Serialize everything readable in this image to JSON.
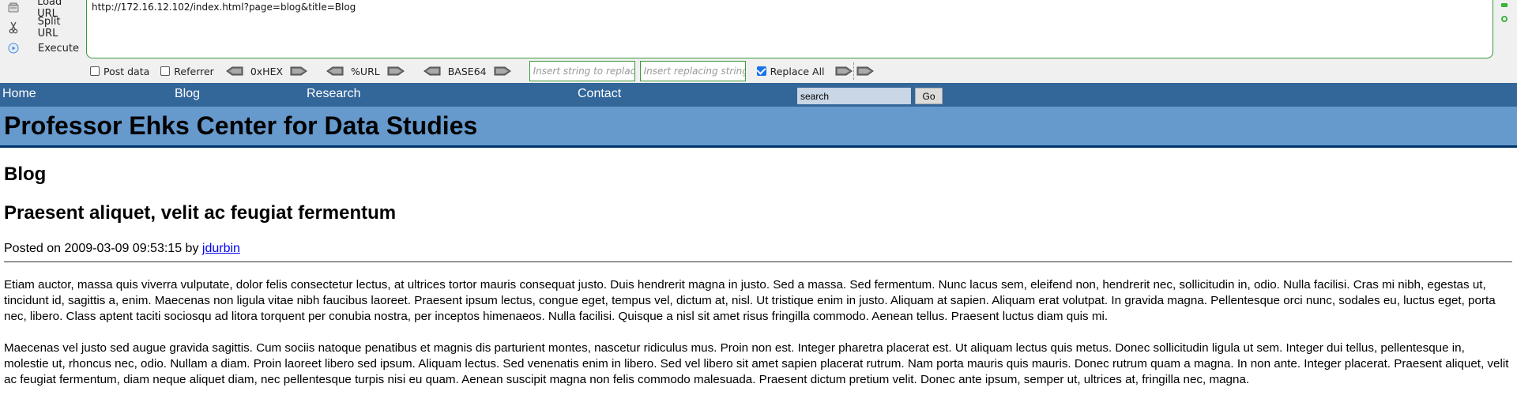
{
  "hackbar": {
    "actions": {
      "load_url": "Load URL",
      "split_url": "Split URL",
      "execute": "Execute"
    },
    "url_value": "http://172.16.12.102/index.html?page=blog&title=Blog",
    "post_data_label": "Post data",
    "post_data_checked": false,
    "referrer_label": "Referrer",
    "referrer_checked": false,
    "encoders": [
      "0xHEX",
      "%URL",
      "BASE64"
    ],
    "find_placeholder": "Insert string to replace",
    "replace_placeholder": "Insert replacing string",
    "replace_all_label": "Replace All",
    "replace_all_checked": true,
    "accent_color": "#3c9a3c"
  },
  "nav": {
    "links": [
      "Home",
      "Blog",
      "Research",
      "Contact"
    ],
    "search_value": "search",
    "go_label": "Go",
    "background_color": "#336699"
  },
  "banner": {
    "title": "Professor Ehks Center for Data Studies",
    "background_color": "#6699cc"
  },
  "content": {
    "section_heading": "Blog",
    "post_title": "Praesent aliquet, velit ac feugiat fermentum",
    "posted_prefix": "Posted on",
    "posted_date": "2009-03-09 09:53:15",
    "posted_by": "by",
    "author": "jdurbin",
    "paragraphs": [
      "Etiam auctor, massa quis viverra vulputate, dolor felis consectetur lectus, at ultrices tortor mauris consequat justo. Duis hendrerit magna in justo. Sed a massa. Sed fermentum. Nunc lacus sem, eleifend non, hendrerit nec, sollicitudin in, odio. Nulla facilisi. Cras mi nibh, egestas ut, tincidunt id, sagittis a, enim. Maecenas non ligula vitae nibh faucibus laoreet. Praesent ipsum lectus, congue eget, tempus vel, dictum at, nisl. Ut tristique enim in justo. Aliquam at sapien. Aliquam erat volutpat. In gravida magna. Pellentesque orci nunc, sodales eu, luctus eget, porta nec, libero. Class aptent taciti sociosqu ad litora torquent per conubia nostra, per inceptos himenaeos. Nulla facilisi. Quisque a nisl sit amet risus fringilla commodo. Aenean tellus. Praesent luctus diam quis mi.",
      "Maecenas vel justo sed augue gravida sagittis. Cum sociis natoque penatibus et magnis dis parturient montes, nascetur ridiculus mus. Proin non est. Integer pharetra placerat est. Ut aliquam lectus quis metus. Donec sollicitudin ligula ut sem. Integer dui tellus, pellentesque in, molestie ut, rhoncus nec, odio. Nullam a diam. Proin laoreet libero sed ipsum. Aliquam lectus. Sed venenatis enim in libero. Sed vel libero sit amet sapien placerat rutrum. Nam porta mauris quis mauris. Donec rutrum quam a magna. In non ante. Integer placerat. Praesent aliquet, velit ac feugiat fermentum, diam neque aliquet diam, nec pellentesque turpis nisi eu quam. Aenean suscipit magna non felis commodo malesuada. Praesent dictum pretium velit. Donec ante ipsum, semper ut, ultrices at, fringilla nec, magna."
    ]
  }
}
